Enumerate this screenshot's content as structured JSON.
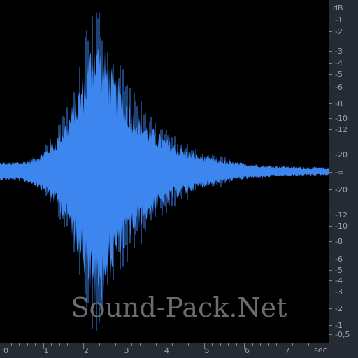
{
  "editor": {
    "db_unit": "dB",
    "time_unit": "sec",
    "watermark": "Sound-Pack.Net"
  },
  "db_ruler": {
    "labels": [
      "-1",
      "-2",
      "-3",
      "-4",
      "-5",
      "-6",
      "-8",
      "-10",
      "-12",
      "-20",
      "-∞",
      "-20",
      "-12",
      "-10",
      "-8",
      "-6",
      "-5",
      "-4",
      "-3",
      "-2",
      "-1",
      "-0,5"
    ]
  },
  "time_ruler": {
    "labels": [
      "0",
      "1",
      "2",
      "3",
      "4",
      "5",
      "6",
      "7"
    ]
  },
  "waveform": {
    "color": "#3d86f0",
    "background": "#000000",
    "duration_sec": 8.1,
    "peak_time_sec": 2.3,
    "peak_level": 0.93
  }
}
